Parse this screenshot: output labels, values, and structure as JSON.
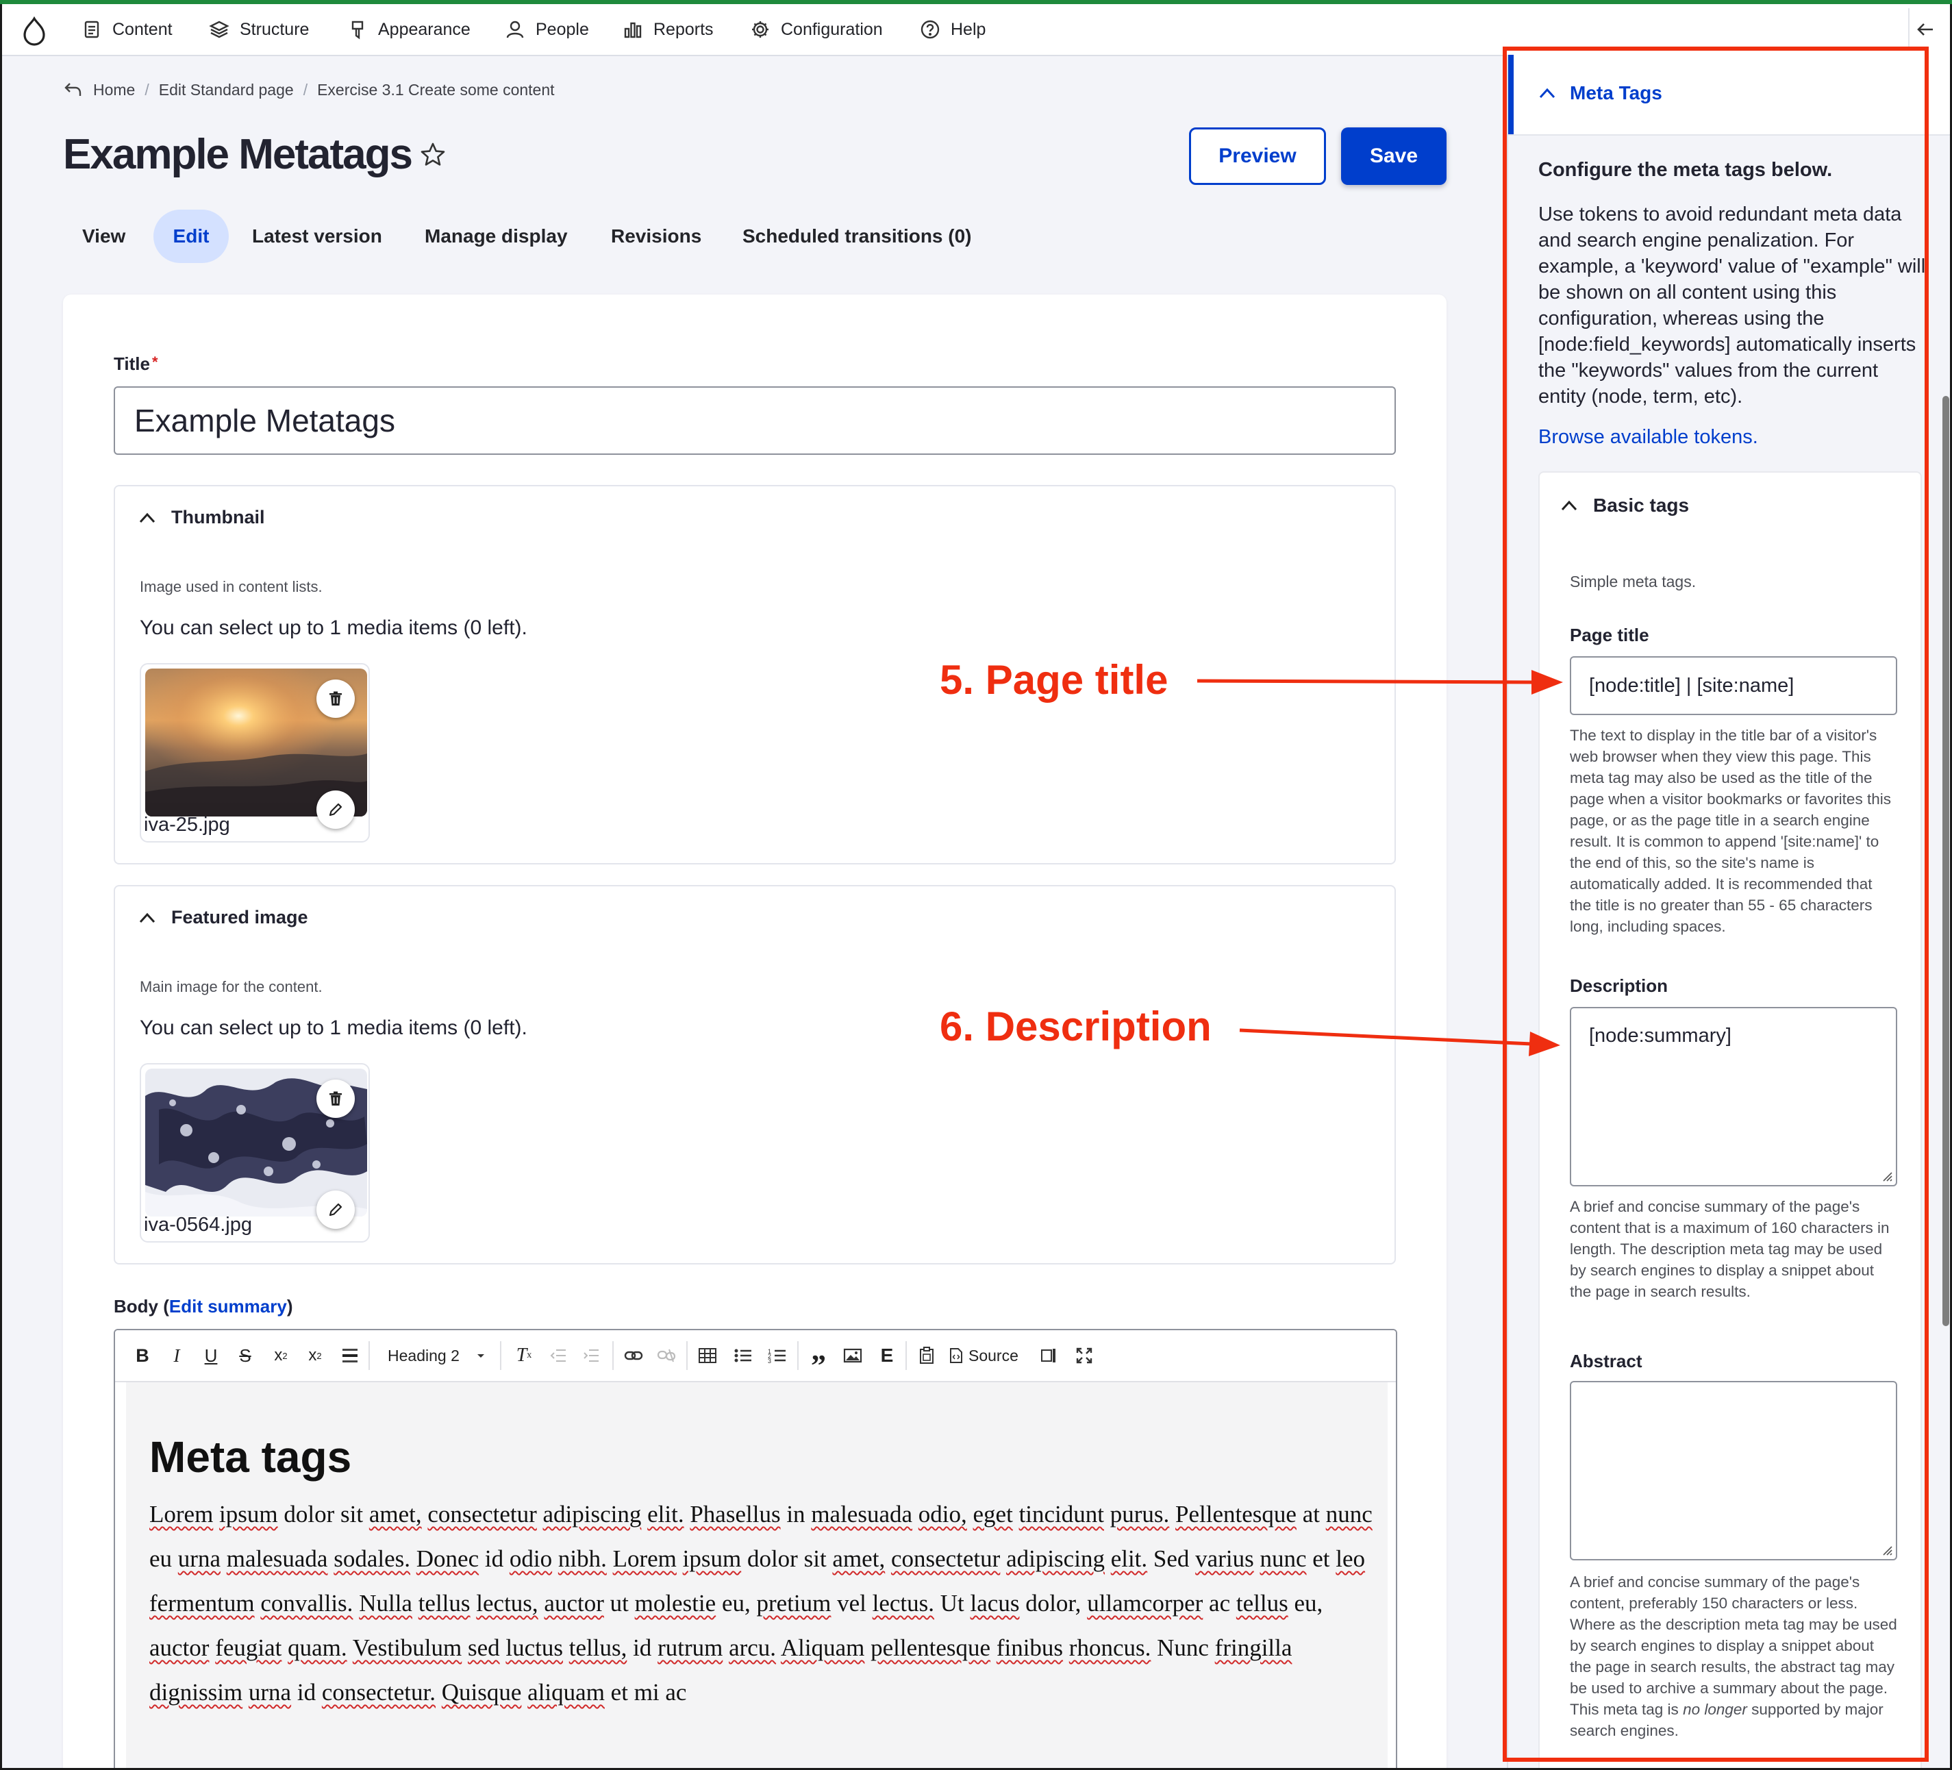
{
  "toolbar": {
    "items": [
      {
        "label": "Content",
        "icon": "content-icon"
      },
      {
        "label": "Structure",
        "icon": "structure-icon"
      },
      {
        "label": "Appearance",
        "icon": "appearance-icon"
      },
      {
        "label": "People",
        "icon": "people-icon"
      },
      {
        "label": "Reports",
        "icon": "reports-icon"
      },
      {
        "label": "Configuration",
        "icon": "configuration-icon"
      },
      {
        "label": "Help",
        "icon": "help-icon"
      }
    ]
  },
  "breadcrumb": {
    "items": [
      "Home",
      "Edit Standard page",
      "Exercise 3.1 Create some content"
    ]
  },
  "page": {
    "title": "Example Metatags",
    "preview_label": "Preview",
    "save_label": "Save"
  },
  "tabs": [
    {
      "label": "View",
      "active": false
    },
    {
      "label": "Edit",
      "active": true
    },
    {
      "label": "Latest version",
      "active": false
    },
    {
      "label": "Manage display",
      "active": false
    },
    {
      "label": "Revisions",
      "active": false
    },
    {
      "label": "Scheduled transitions (0)",
      "active": false
    }
  ],
  "form": {
    "title_label": "Title",
    "title_value": "Example Metatags",
    "thumbnail": {
      "heading": "Thumbnail",
      "description": "Image used in content lists.",
      "limit": "You can select up to 1 media items (0 left).",
      "file": "iva-25.jpg"
    },
    "featured": {
      "heading": "Featured image",
      "description": "Main image for the content.",
      "limit": "You can select up to 1 media items (0 left).",
      "file": "iva-0564.jpg"
    },
    "body_label": "Body",
    "edit_summary": "Edit summary"
  },
  "editor": {
    "heading_select": "Heading 2",
    "source_label": "Source",
    "content_heading": "Meta tags",
    "content_paragraph": "Lorem ipsum dolor sit amet, consectetur adipiscing elit. Phasellus in malesuada odio, eget tincidunt purus. Pellentesque at nunc eu urna malesuada sodales. Donec id odio nibh. Lorem ipsum dolor sit amet, consectetur adipiscing elit. Sed varius nunc et leo fermentum convallis. Nulla tellus lectus, auctor ut molestie eu, pretium vel lectus. Ut lacus dolor, ullamcorper ac tellus eu, auctor feugiat quam. Vestibulum sed luctus tellus, id rutrum arcu. Aliquam pellentesque finibus rhoncus. Nunc fringilla dignissim urna id consectetur. Quisque aliquam et mi ac"
  },
  "sidebar": {
    "heading": "Meta Tags",
    "configure": "Configure the meta tags below.",
    "intro": "Use tokens to avoid redundant meta data and search engine penalization. For example, a 'keyword' value of \"example\" will be shown on all content using this configuration, whereas using the [node:field_keywords] automatically inserts the \"keywords\" values from the current entity (node, term, etc).",
    "browse_tokens": "Browse available tokens.",
    "basic_tags": "Basic tags",
    "basic_desc": "Simple meta tags.",
    "page_title_label": "Page title",
    "page_title_value": "[node:title] | [site:name]",
    "page_title_help": "The text to display in the title bar of a visitor's web browser when they view this page. This meta tag may also be used as the title of the page when a visitor bookmarks or favorites this page, or as the page title in a search engine result. It is common to append '[site:name]' to the end of this, so the site's name is automatically added. It is recommended that the title is no greater than 55 - 65 characters long, including spaces.",
    "description_label": "Description",
    "description_value": "[node:summary]",
    "description_help": "A brief and concise summary of the page's content that is a maximum of 160 characters in length. The description meta tag may be used by search engines to display a snippet about the page in search results.",
    "abstract_label": "Abstract",
    "abstract_value": "",
    "abstract_help_1": "A brief and concise summary of the page's content, preferably 150 characters or less. Where as the description meta tag may be used by search engines to display a snippet about the page in search results, the abstract tag may be used to archive a summary about the page. This meta tag is",
    "abstract_help_em": "no longer",
    "abstract_help_2": "supported by major search engines."
  },
  "annotations": {
    "page_title": "5. Page title",
    "description": "6. Description"
  },
  "colors": {
    "accent": "#003ecc",
    "annotation": "#ef2e10",
    "active_tab_bg": "#d4e1ff"
  }
}
